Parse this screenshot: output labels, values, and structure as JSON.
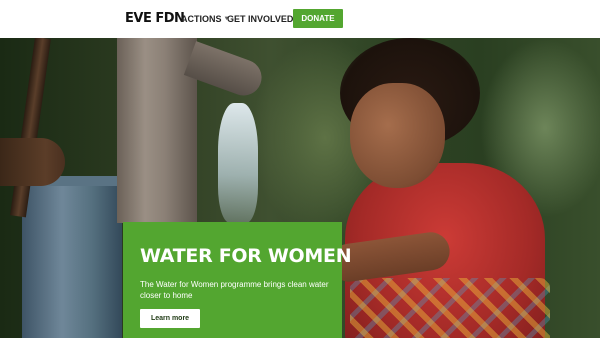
{
  "header": {
    "logo": "EVE FDN",
    "nav": [
      {
        "label": "ACTIONS",
        "has_dropdown": true
      },
      {
        "label": "GET INVOLVED",
        "has_dropdown": true
      }
    ],
    "donate_label": "DONATE"
  },
  "hero": {
    "image_description_icon": "hero-photo",
    "card": {
      "title": "WATER FOR WOMEN",
      "description": "The Water for Women programme brings clean water closer to home",
      "button_label": "Learn more"
    }
  },
  "colors": {
    "brand_green": "#53a630",
    "header_bg": "#ffffff",
    "text_dark": "#222222"
  }
}
